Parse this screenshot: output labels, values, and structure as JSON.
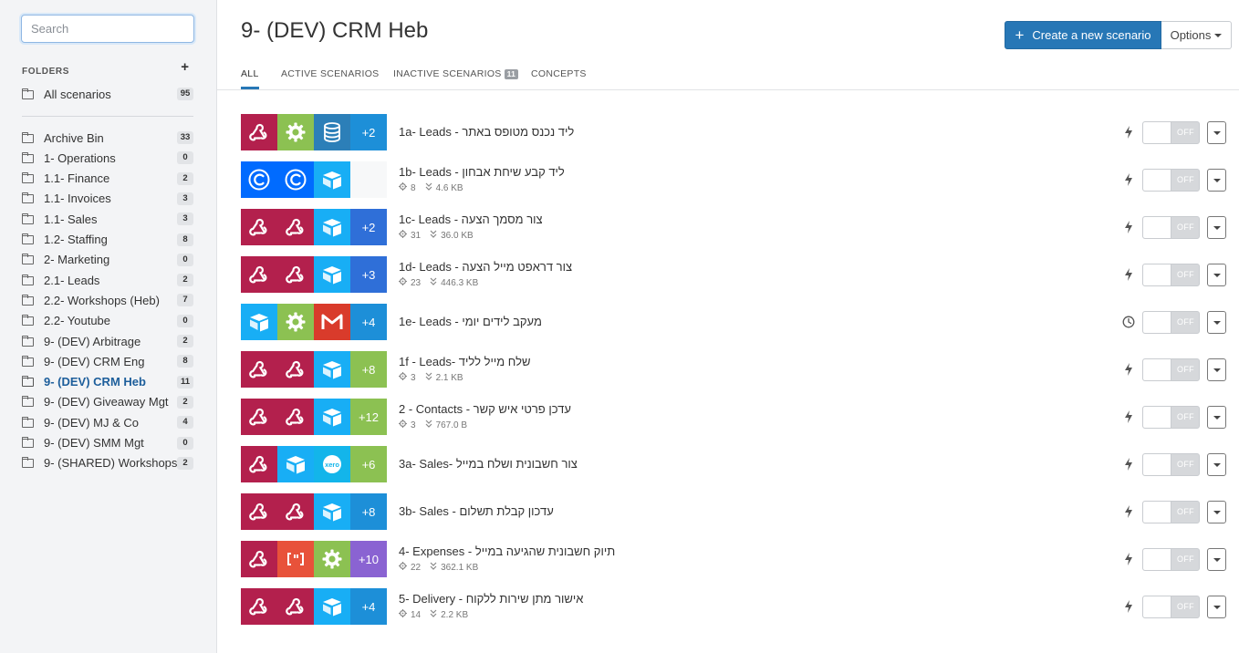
{
  "search": {
    "placeholder": "Search"
  },
  "sidebar": {
    "folders_title": "FOLDERS",
    "add_symbol": "+",
    "all": {
      "label": "All scenarios",
      "count": "95"
    },
    "items": [
      {
        "label": "Archive Bin",
        "count": "33"
      },
      {
        "label": "1- Operations",
        "count": "0"
      },
      {
        "label": "1.1- Finance",
        "count": "2"
      },
      {
        "label": "1.1- Invoices",
        "count": "3"
      },
      {
        "label": "1.1- Sales",
        "count": "3"
      },
      {
        "label": "1.2- Staffing",
        "count": "8"
      },
      {
        "label": "2- Marketing",
        "count": "0"
      },
      {
        "label": "2.1- Leads",
        "count": "2"
      },
      {
        "label": "2.2- Workshops (Heb)",
        "count": "7"
      },
      {
        "label": "2.2- Youtube",
        "count": "0"
      },
      {
        "label": "9- (DEV) Arbitrage",
        "count": "2"
      },
      {
        "label": "9- (DEV) CRM Eng",
        "count": "8"
      },
      {
        "label": "9- (DEV) CRM Heb",
        "count": "11",
        "active": true
      },
      {
        "label": "9- (DEV) Giveaway Mgt",
        "count": "2"
      },
      {
        "label": "9- (DEV) MJ & Co",
        "count": "4"
      },
      {
        "label": "9- (DEV) SMM Mgt",
        "count": "0"
      },
      {
        "label": "9- (SHARED) Workshops",
        "count": "2"
      }
    ]
  },
  "header": {
    "title": "9- (DEV) CRM Heb",
    "create_label": "Create a new scenario",
    "create_icon": "+",
    "options_label": "Options"
  },
  "tabs": [
    {
      "label": "ALL",
      "active": true
    },
    {
      "label": "ACTIVE SCENARIOS"
    },
    {
      "label": "INACTIVE SCENARIOS",
      "badge": "11"
    },
    {
      "label": "CONCEPTS"
    }
  ],
  "colors": {
    "webhook": "#b3204d",
    "tools": "#8cc152",
    "datastore": "#2c7fb8",
    "airtable": "#18aef5",
    "calendly": "#006bff",
    "gmail": "#d93b2b",
    "xero": "#13b5ea",
    "parser": "#e8523a",
    "more_blue": "#2f6fd8",
    "more_airtable": "#1d8fd8",
    "more_green": "#8cc152",
    "more_purple": "#8a63d2",
    "accent": "#2777b6"
  },
  "scenarios": [
    {
      "name": "1a- Leads - ליד נכנס מטופס באתר",
      "modules": [
        "webhook-icon",
        "gear-icon",
        "database-icon"
      ],
      "colors": [
        "webhook",
        "tools",
        "datastore"
      ],
      "more": "+2",
      "more_color": "more_airtable",
      "trigger": "bolt-icon",
      "status": "OFF"
    },
    {
      "name": "1b- Leads - ליד קבע שיחת אבחון",
      "modules": [
        "calendly-icon",
        "calendly-icon",
        "airtable-icon"
      ],
      "colors": [
        "calendly",
        "calendly",
        "airtable"
      ],
      "more": "",
      "more_color": "",
      "ops": "8",
      "size": "4.6 KB",
      "trigger": "bolt-icon",
      "status": "OFF"
    },
    {
      "name": "1c- Leads - צור מסמך הצעה",
      "modules": [
        "webhook-icon",
        "webhook-icon",
        "airtable-icon"
      ],
      "colors": [
        "webhook",
        "webhook",
        "airtable"
      ],
      "more": "+2",
      "more_color": "more_blue",
      "ops": "31",
      "size": "36.0 KB",
      "trigger": "bolt-icon",
      "status": "OFF"
    },
    {
      "name": "1d- Leads - צור דראפט מייל הצעה",
      "modules": [
        "webhook-icon",
        "webhook-icon",
        "airtable-icon"
      ],
      "colors": [
        "webhook",
        "webhook",
        "airtable"
      ],
      "more": "+3",
      "more_color": "more_blue",
      "ops": "23",
      "size": "446.3 KB",
      "trigger": "bolt-icon",
      "status": "OFF"
    },
    {
      "name": "1e- Leads - מעקב לידים יומי",
      "modules": [
        "airtable-icon",
        "gear-icon",
        "gmail-icon"
      ],
      "colors": [
        "airtable",
        "tools",
        "gmail"
      ],
      "more": "+4",
      "more_color": "more_airtable",
      "trigger": "clock-icon",
      "status": "OFF"
    },
    {
      "name": "1f - Leads- שלח מייל לליד",
      "modules": [
        "webhook-icon",
        "webhook-icon",
        "airtable-icon"
      ],
      "colors": [
        "webhook",
        "webhook",
        "airtable"
      ],
      "more": "+8",
      "more_color": "more_green",
      "ops": "3",
      "size": "2.1 KB",
      "trigger": "bolt-icon",
      "status": "OFF"
    },
    {
      "name": "2 - Contacts - עדכן פרטי איש קשר",
      "modules": [
        "webhook-icon",
        "webhook-icon",
        "airtable-icon"
      ],
      "colors": [
        "webhook",
        "webhook",
        "airtable"
      ],
      "more": "+12",
      "more_color": "more_green",
      "ops": "3",
      "size": "767.0 B",
      "trigger": "bolt-icon",
      "status": "OFF"
    },
    {
      "name": "3a- Sales- צור חשבונית ושלח במייל",
      "modules": [
        "webhook-icon",
        "airtable-icon",
        "xero-icon"
      ],
      "colors": [
        "webhook",
        "airtable",
        "xero"
      ],
      "more": "+6",
      "more_color": "more_green",
      "trigger": "bolt-icon",
      "status": "OFF"
    },
    {
      "name": "3b- Sales - עדכון קבלת תשלום",
      "modules": [
        "webhook-icon",
        "webhook-icon",
        "airtable-icon"
      ],
      "colors": [
        "webhook",
        "webhook",
        "airtable"
      ],
      "more": "+8",
      "more_color": "more_airtable",
      "trigger": "bolt-icon",
      "status": "OFF"
    },
    {
      "name": "4- Expenses - תיוק חשבונית שהגיעה במייל",
      "modules": [
        "webhook-icon",
        "parser-icon",
        "gear-icon"
      ],
      "colors": [
        "webhook",
        "parser",
        "tools"
      ],
      "more": "+10",
      "more_color": "more_purple",
      "ops": "22",
      "size": "362.1 KB",
      "trigger": "bolt-icon",
      "status": "OFF"
    },
    {
      "name": "5- Delivery - אישור מתן שירות ללקוח",
      "modules": [
        "webhook-icon",
        "webhook-icon",
        "airtable-icon"
      ],
      "colors": [
        "webhook",
        "webhook",
        "airtable"
      ],
      "more": "+4",
      "more_color": "more_airtable",
      "ops": "14",
      "size": "2.2 KB",
      "trigger": "bolt-icon",
      "status": "OFF"
    }
  ]
}
